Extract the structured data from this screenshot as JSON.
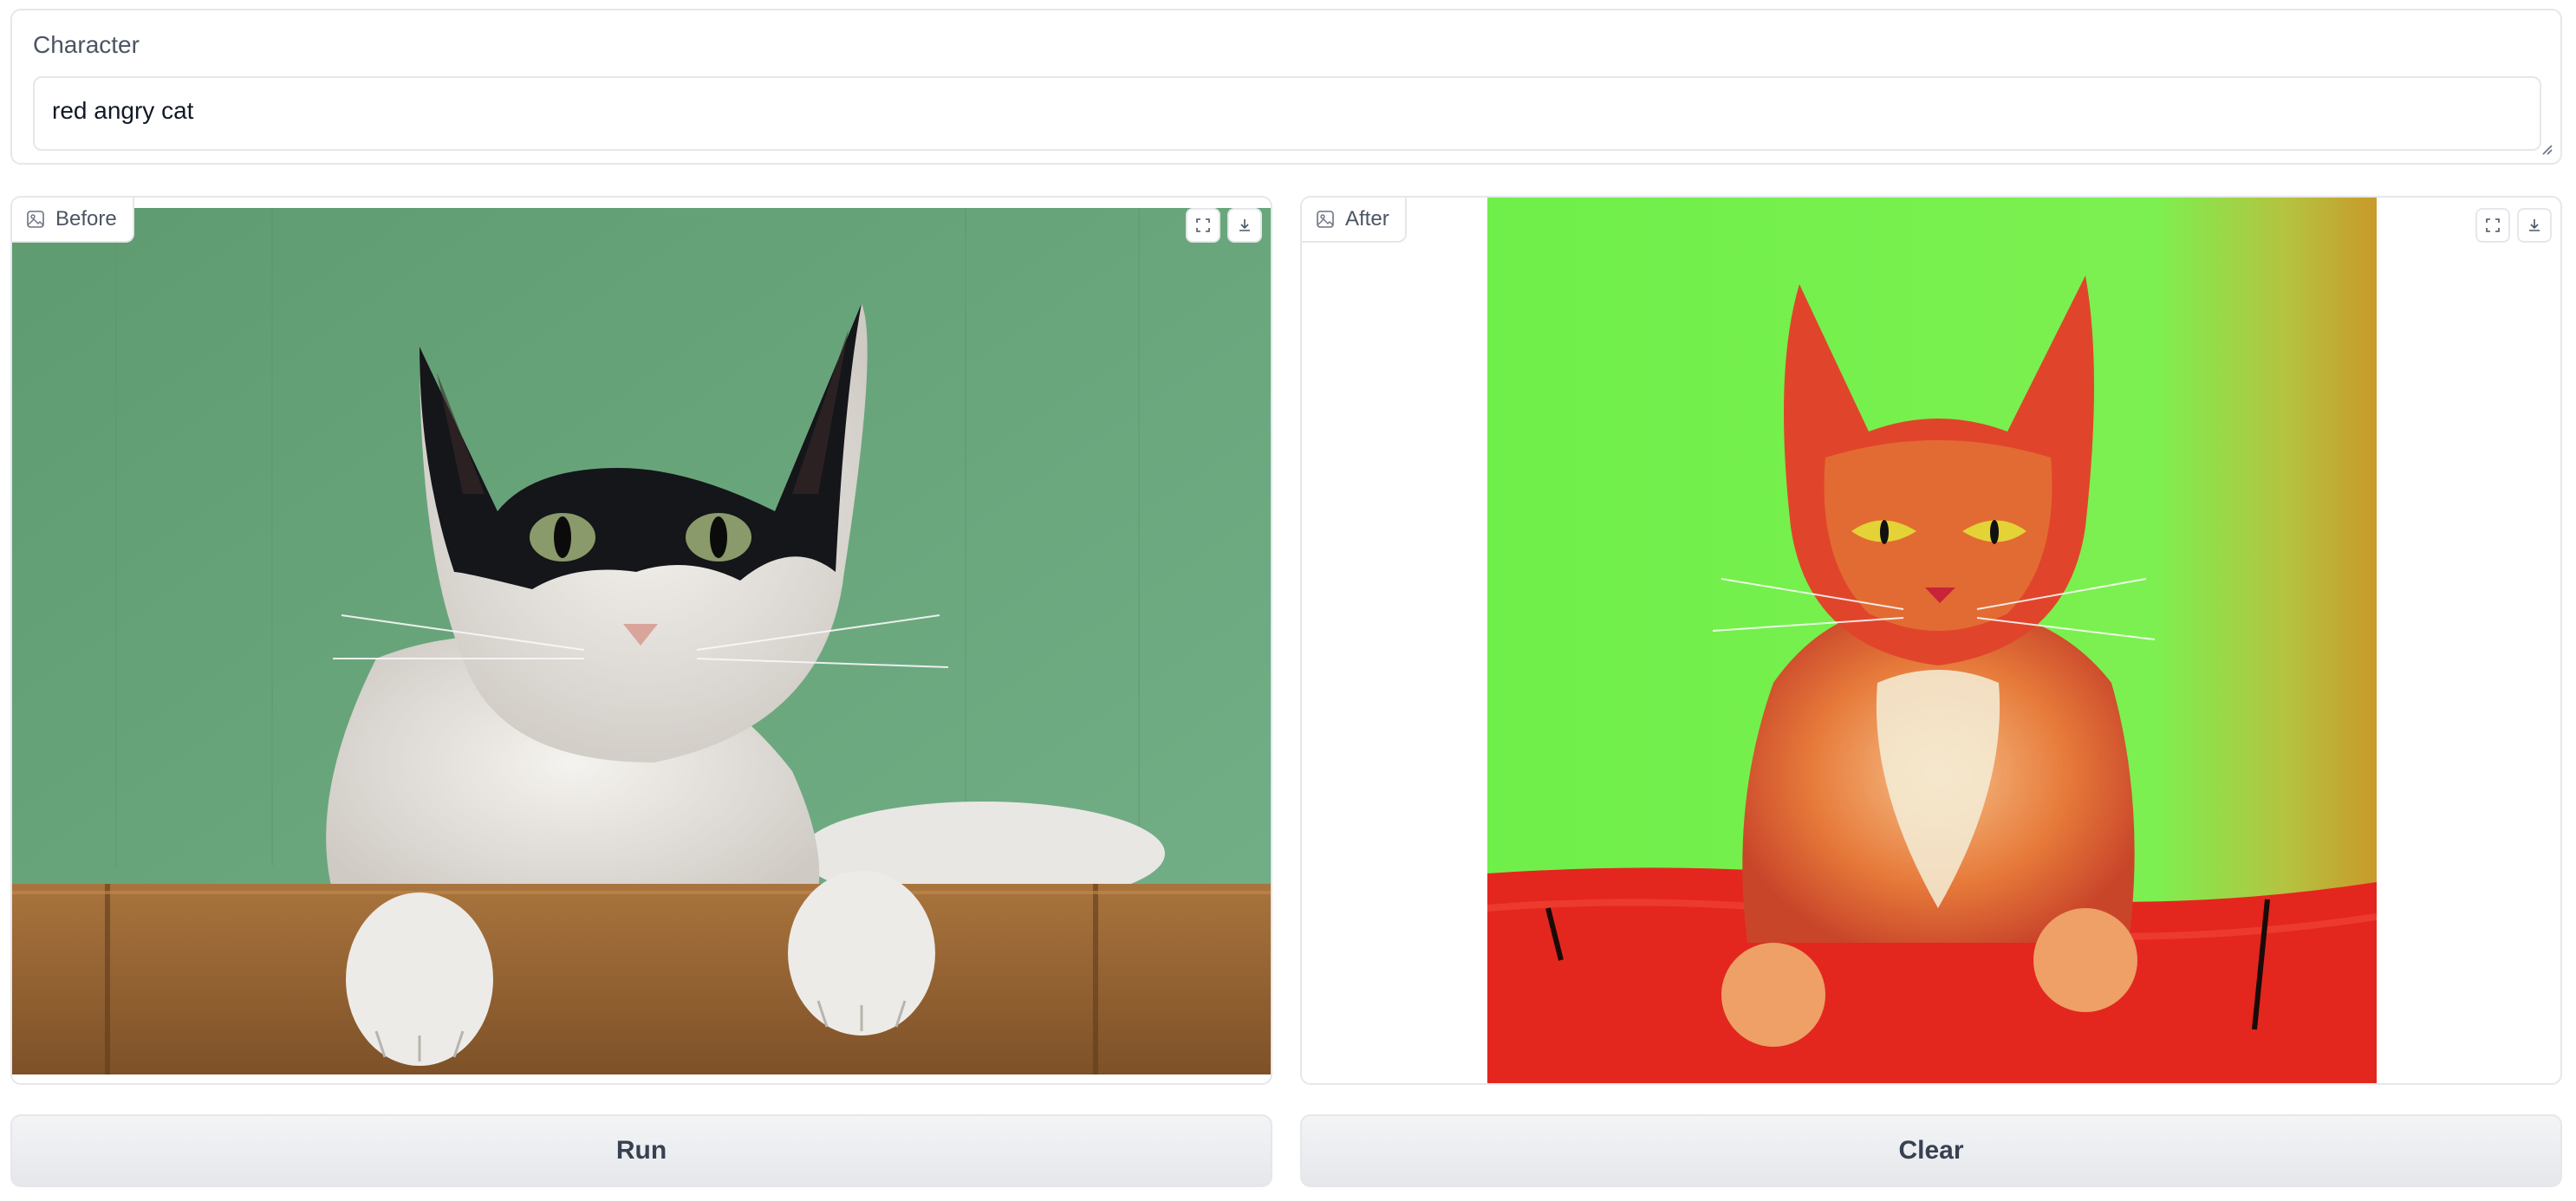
{
  "character": {
    "label": "Character",
    "value": "red angry cat"
  },
  "before_panel": {
    "label": "Before",
    "image_icon": "image-icon",
    "actions": [
      "fullscreen-icon",
      "download-icon"
    ]
  },
  "after_panel": {
    "label": "After",
    "image_icon": "image-icon",
    "actions": [
      "fullscreen-icon",
      "download-icon"
    ]
  },
  "buttons": {
    "run_label": "Run",
    "clear_label": "Clear"
  },
  "colors": {
    "border": "#e5e7eb",
    "button_bg": "#e5e7eb",
    "label_text": "#4b5563"
  }
}
